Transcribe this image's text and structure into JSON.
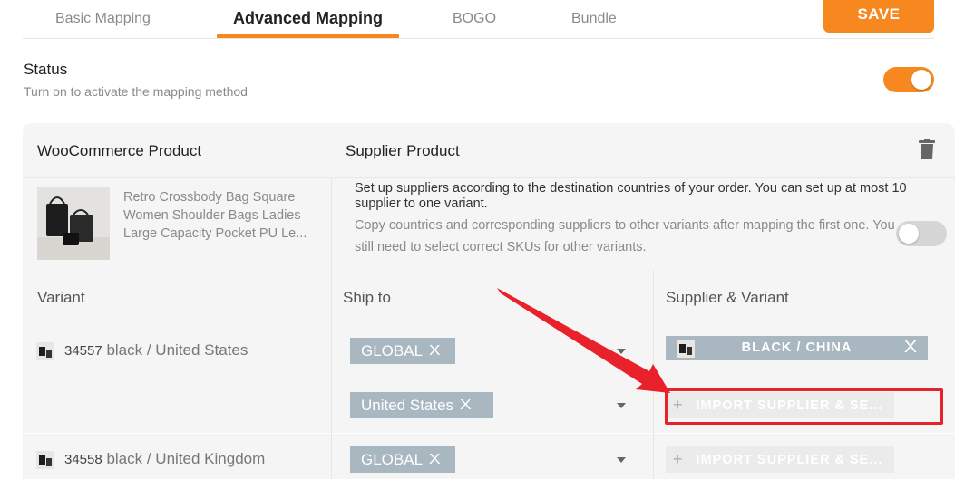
{
  "tabs": {
    "items": [
      {
        "label": "Basic Mapping"
      },
      {
        "label": "Advanced Mapping"
      },
      {
        "label": "BOGO"
      },
      {
        "label": "Bundle"
      }
    ],
    "active": "Advanced Mapping",
    "save_label": "SAVE"
  },
  "status": {
    "title": "Status",
    "subtitle": "Turn on to activate the mapping method",
    "enabled": true
  },
  "card": {
    "col_woo": "WooCommerce Product",
    "col_supplier": "Supplier Product",
    "product": {
      "name_lines": [
        "Retro Crossbody Bag Square",
        "Women Shoulder Bags Ladies",
        "Large Capacity Pocket PU Le..."
      ]
    },
    "info_text": "Set up suppliers according to the destination countries of your order. You can set up at most 10 supplier to one variant.",
    "copy_text": "Copy countries and corresponding suppliers to other variants after mapping the first one. You still need to select correct SKUs for other variants.",
    "copy_enabled": false
  },
  "variants": {
    "headers": {
      "variant": "Variant",
      "ship_to": "Ship to",
      "supplier": "Supplier & Variant"
    },
    "rows": [
      {
        "id": "34557",
        "name": "black / United States",
        "ship_tags": [
          "GLOBAL",
          "United States"
        ],
        "supplier_tag": "BLACK / CHINA",
        "import_label": "IMPORT SUPPLIER & SE..."
      },
      {
        "id": "34558",
        "name": "black / United Kingdom",
        "ship_tags": [
          "GLOBAL"
        ],
        "import_label": "IMPORT SUPPLIER & SE..."
      }
    ]
  },
  "colors": {
    "accent": "#f7881f",
    "tag": "#a9b7c1",
    "annotation": "#e8212b"
  }
}
